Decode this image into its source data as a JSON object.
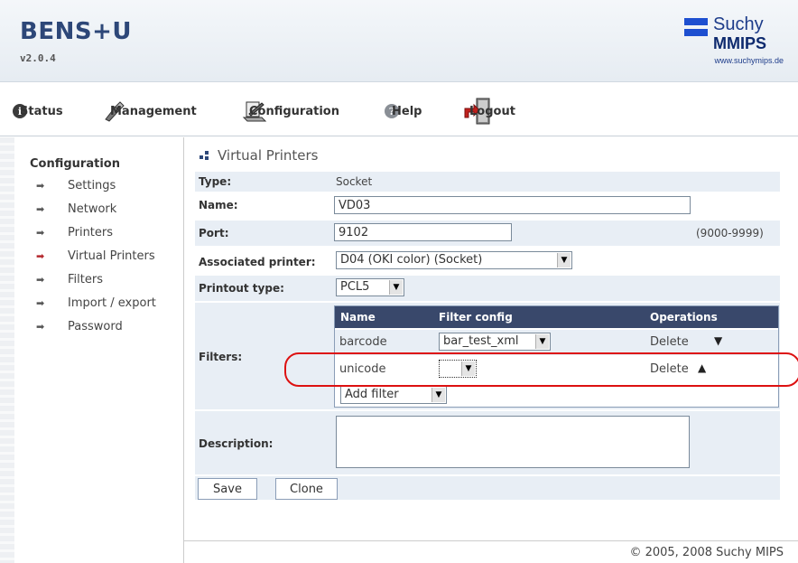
{
  "app": {
    "title": "BENS+U",
    "version": "v2.0.4"
  },
  "logo": {
    "word1": "Suchy",
    "word2": "MIPS",
    "mark_letter": "M",
    "url": "www.suchymips.de"
  },
  "menu": {
    "status": "Status",
    "management": "Management",
    "configuration": "Configuration",
    "help": "Help",
    "logout": "Logout"
  },
  "sidebar": {
    "title": "Configuration",
    "items": [
      {
        "label": "Settings",
        "active": false
      },
      {
        "label": "Network",
        "active": false
      },
      {
        "label": "Printers",
        "active": false
      },
      {
        "label": "Virtual Printers",
        "active": true
      },
      {
        "label": "Filters",
        "active": false
      },
      {
        "label": "Import / export",
        "active": false
      },
      {
        "label": "Password",
        "active": false
      }
    ]
  },
  "panel": {
    "title": "Virtual Printers",
    "type_label": "Type:",
    "type_value": "Socket",
    "name_label": "Name:",
    "name_value": "VD03",
    "port_label": "Port:",
    "port_value": "9102",
    "port_hint": "(9000-9999)",
    "assoc_label": "Associated printer:",
    "assoc_value": "D04 (OKI color) (Socket)",
    "printout_label": "Printout type:",
    "printout_value": "PCL5",
    "filters_label": "Filters:",
    "filters_headers": {
      "name": "Name",
      "config": "Filter config",
      "ops": "Operations"
    },
    "filters": [
      {
        "name": "barcode",
        "config": "bar_test_xml",
        "op": "Delete",
        "move": "▼"
      },
      {
        "name": "unicode",
        "config": "",
        "op": "Delete",
        "move": "▲"
      }
    ],
    "add_filter": "Add filter",
    "description_label": "Description:",
    "description_value": "",
    "save": "Save",
    "clone": "Clone"
  },
  "footer": {
    "copyright": "© 2005, 2008 Suchy MIPS"
  },
  "colors": {
    "brand": "#2d4778",
    "table_header": "#39486b",
    "row_bg": "#e8eef5",
    "highlight": "#dd1111"
  }
}
